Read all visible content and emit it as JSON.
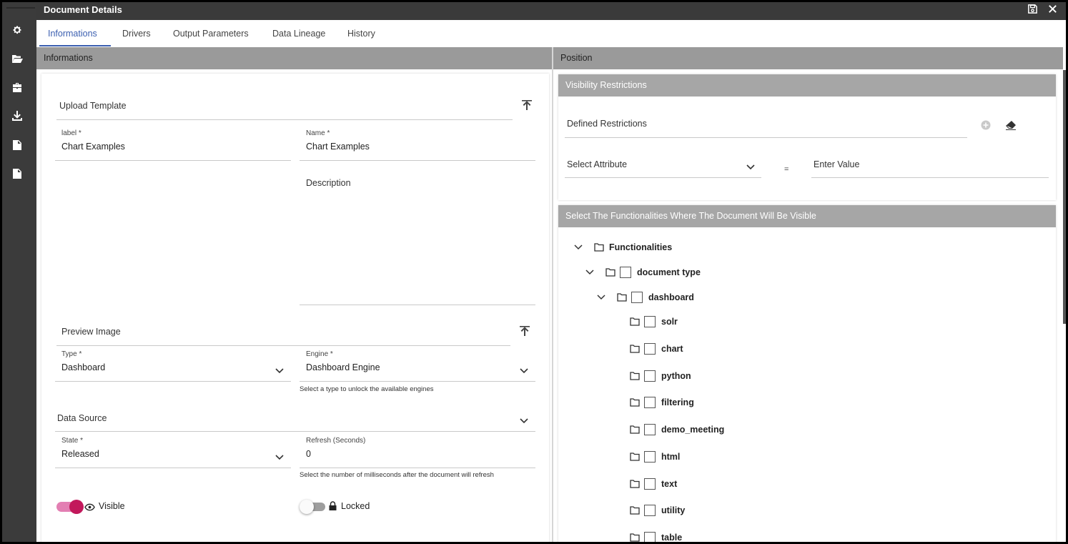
{
  "window": {
    "title": "Document Details"
  },
  "rail_icons": [
    "gear-icon",
    "folder-open-icon",
    "briefcase-icon",
    "download-icon",
    "document-icon",
    "document-icon"
  ],
  "tabs": [
    {
      "label": "Informations",
      "active": true
    },
    {
      "label": "Drivers"
    },
    {
      "label": "Output Parameters"
    },
    {
      "label": "Data Lineage"
    },
    {
      "label": "History"
    }
  ],
  "informations": {
    "header": "Informations",
    "upload_template": "Upload Template",
    "label_field": {
      "label": "label *",
      "value": "Chart Examples"
    },
    "name_field": {
      "label": "Name *",
      "value": "Chart Examples"
    },
    "description": {
      "placeholder": "Description"
    },
    "preview_image": "Preview Image",
    "type_field": {
      "label": "Type *",
      "value": "Dashboard"
    },
    "engine_field": {
      "label": "Engine *",
      "value": "Dashboard Engine",
      "hint": "Select a type to unlock the available engines"
    },
    "data_source": {
      "placeholder": "Data Source"
    },
    "state_field": {
      "label": "State *",
      "value": "Released"
    },
    "refresh_field": {
      "label": "Refresh (Seconds)",
      "value": "0",
      "hint": "Select the number of milliseconds after the document will refresh"
    },
    "visible_toggle": {
      "label": "Visible",
      "on": true
    },
    "locked_toggle": {
      "label": "Locked",
      "on": false
    }
  },
  "position": {
    "header": "Position",
    "visibility": {
      "header": "Visibility Restrictions",
      "defined_restrictions": "Defined Restrictions",
      "select_attribute": "Select Attribute",
      "equals": "=",
      "enter_value": "Enter Value"
    },
    "functionalities": {
      "header": "Select The Functionalities Where The Document Will Be Visible",
      "root": "Functionalities",
      "document_type": "document type",
      "dashboard": "dashboard",
      "children": [
        "solr",
        "chart",
        "python",
        "filtering",
        "demo_meeting",
        "html",
        "text",
        "utility",
        "table"
      ]
    }
  },
  "colors": {
    "accent": "#3b5fb0",
    "toggle_on": "#c2185b",
    "header_bg": "#9a9a9a",
    "rail_bg": "#3b3b3b"
  }
}
